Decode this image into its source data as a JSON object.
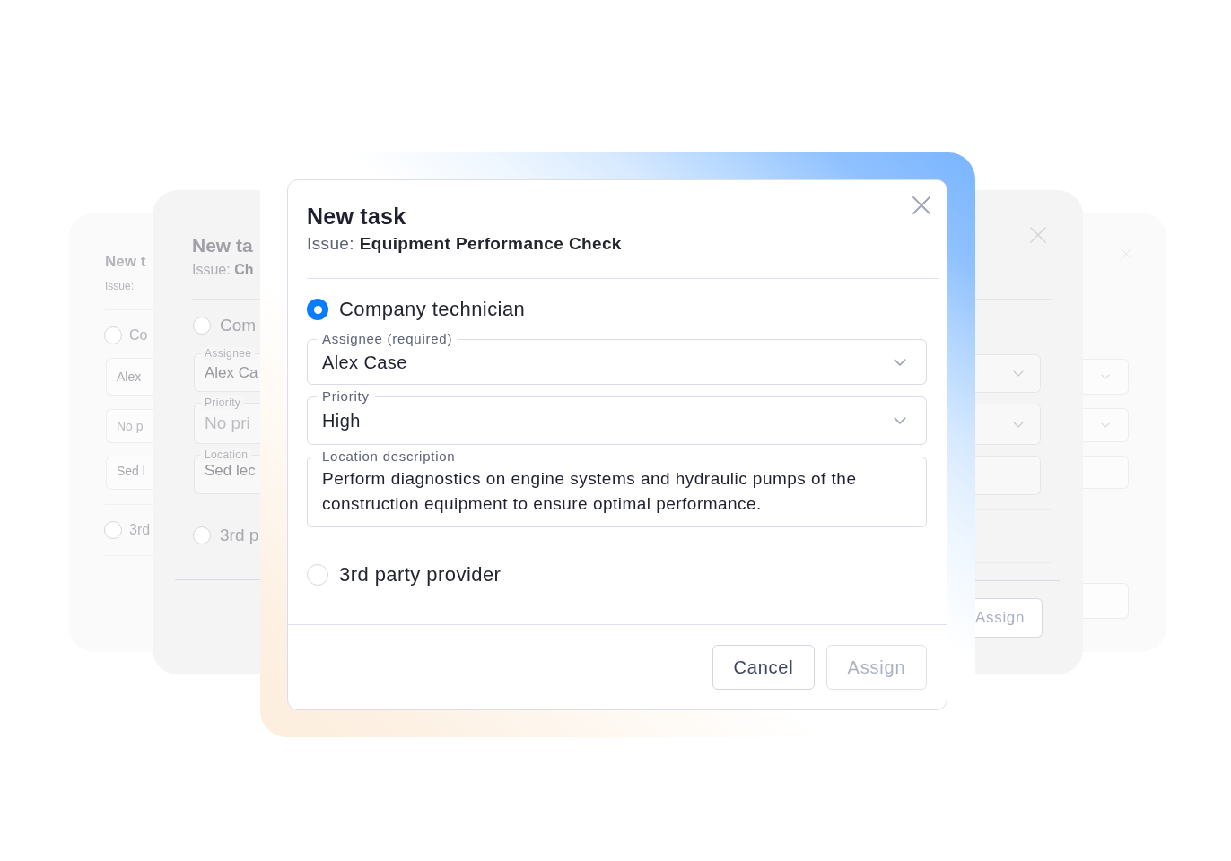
{
  "background_left": {
    "far": {
      "title": "New t",
      "issue": "Issue:",
      "options": [
        {
          "label": "Co",
          "selected": false,
          "fields": [
            {
              "kind": "select",
              "value": "Alex"
            },
            {
              "kind": "select",
              "placeholder": "No p"
            },
            {
              "kind": "textarea",
              "value": "Sed l"
            }
          ]
        },
        {
          "label": "3rd",
          "selected": false
        }
      ]
    },
    "near": {
      "title": "New ta",
      "issue": "Issue: **Ch**",
      "options": [
        {
          "label": "Com",
          "selected": false,
          "fields": [
            {
              "kind": "select",
              "label": "Assignee",
              "value": "Alex Ca"
            },
            {
              "kind": "select",
              "label": "Priority",
              "placeholder": "No pri"
            },
            {
              "kind": "textarea",
              "label": "Location",
              "value": "Sed lec"
            }
          ]
        },
        {
          "label": "3rd p",
          "selected": false
        }
      ]
    }
  },
  "dialog": {
    "title": "New task",
    "issue": "Issue: **Equipment Performance Check**",
    "options": [
      {
        "label": "Company technician",
        "selected": true,
        "fields": [
          {
            "kind": "select",
            "label": "Assignee (required)",
            "value": "Alex Case"
          },
          {
            "kind": "select",
            "label": "Priority",
            "value": "High"
          },
          {
            "kind": "textarea",
            "label": "Location description",
            "value": "Perform diagnostics on engine systems and hydraulic pumps of the construction equipment to ensure optimal performance."
          }
        ]
      },
      {
        "label": "3rd party provider",
        "selected": false
      }
    ],
    "buttons": [
      {
        "label": "Cancel",
        "disabled": false
      },
      {
        "label": "Assign",
        "disabled": true
      }
    ]
  },
  "background_right": {
    "near": {
      "fields": [
        {
          "kind": "select"
        },
        {
          "kind": "select"
        },
        {
          "kind": "textarea"
        }
      ],
      "buttons": [
        {
          "label": "Assign",
          "disabled": true
        }
      ]
    },
    "far": {
      "fields": [
        {
          "kind": "select"
        },
        {
          "kind": "select"
        },
        {
          "kind": "textarea"
        }
      ],
      "buttons": [
        {
          "disabled": true
        }
      ]
    }
  }
}
